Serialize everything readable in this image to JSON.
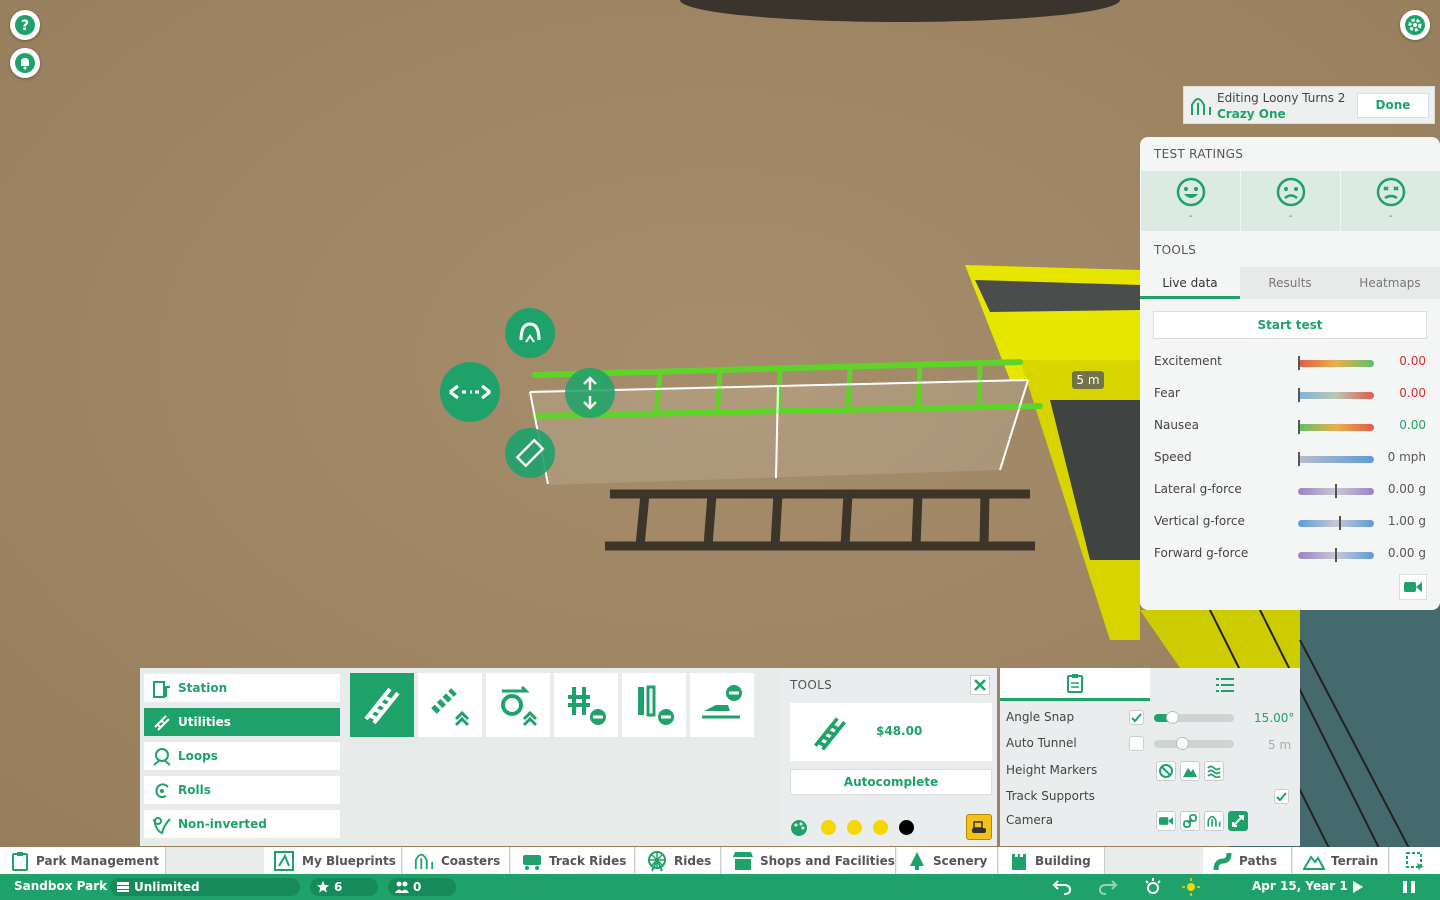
{
  "top_left": {
    "help_icon": "help-icon",
    "notifications_icon": "bell-icon"
  },
  "top_right": {
    "settings_icon": "gear-icon"
  },
  "viewport": {
    "segment_length_label": "5 m"
  },
  "editing": {
    "line1": "Editing Loony Turns 2",
    "line2": "Crazy One",
    "done_label": "Done"
  },
  "right_panel": {
    "test_ratings_title": "TEST RATINGS",
    "ratings": [
      {
        "icon": "happy-face-icon",
        "value": "-"
      },
      {
        "icon": "neutral-face-icon",
        "value": "-"
      },
      {
        "icon": "sad-face-icon",
        "value": "-"
      }
    ],
    "tools_title": "TOOLS",
    "tabs": [
      {
        "label": "Live data"
      },
      {
        "label": "Results"
      },
      {
        "label": "Heatmaps"
      }
    ],
    "start_test_label": "Start test",
    "stats": [
      {
        "label": "Excitement",
        "value": "0.00",
        "value_color": "#d0312d"
      },
      {
        "label": "Fear",
        "value": "0.00",
        "value_color": "#d0312d"
      },
      {
        "label": "Nausea",
        "value": "0.00",
        "value_color": "#1fa26a"
      },
      {
        "label": "Speed",
        "value": "0 mph",
        "value_color": "#555555"
      },
      {
        "label": "Lateral g-force",
        "value": "0.00 g",
        "value_color": "#555555"
      },
      {
        "label": "Vertical g-force",
        "value": "1.00 g",
        "value_color": "#555555"
      },
      {
        "label": "Forward g-force",
        "value": "0.00 g",
        "value_color": "#555555"
      }
    ]
  },
  "categories": [
    {
      "label": "Station",
      "icon": "station-icon"
    },
    {
      "label": "Utilities",
      "icon": "utilities-icon"
    },
    {
      "label": "Loops",
      "icon": "loop-icon"
    },
    {
      "label": "Rolls",
      "icon": "roll-icon"
    },
    {
      "label": "Non-inverted",
      "icon": "non-inverted-icon"
    }
  ],
  "track_pieces": [
    "straight-track-icon",
    "chain-lift-icon",
    "booster-icon",
    "brake-remove-icon",
    "block-brake-remove-icon",
    "launch-remove-icon"
  ],
  "tools_panel": {
    "title": "TOOLS",
    "price": "$48.00",
    "autocomplete_label": "Autocomplete",
    "swatch_colors": [
      "#f5d800",
      "#f5d800",
      "#f5d800",
      "#000000"
    ]
  },
  "settings_panel": {
    "angle_snap_label": "Angle Snap",
    "angle_snap_value": "15.00°",
    "auto_tunnel_label": "Auto Tunnel",
    "auto_tunnel_value": "5 m",
    "height_markers_label": "Height Markers",
    "track_supports_label": "Track Supports",
    "camera_label": "Camera"
  },
  "taskbar": [
    {
      "label": "Park Management",
      "icon": "clipboard-icon"
    },
    {
      "label": "My Blueprints",
      "icon": "blueprint-icon"
    },
    {
      "label": "Coasters",
      "icon": "coaster-icon"
    },
    {
      "label": "Track Rides",
      "icon": "train-icon"
    },
    {
      "label": "Rides",
      "icon": "ferris-wheel-icon"
    },
    {
      "label": "Shops and Facilities",
      "icon": "shop-icon"
    },
    {
      "label": "Scenery",
      "icon": "tree-icon"
    },
    {
      "label": "Building",
      "icon": "tower-icon"
    },
    {
      "label": "Paths",
      "icon": "path-icon"
    },
    {
      "label": "Terrain",
      "icon": "terrain-icon"
    }
  ],
  "status": {
    "park_name": "Sandbox Park",
    "money": "Unlimited",
    "rating": "6",
    "guests": "0",
    "date": "Apr 15, Year 1"
  },
  "colors": {
    "accent": "#1fa26a",
    "track": "#5fd32a",
    "support": "#e6e600"
  }
}
